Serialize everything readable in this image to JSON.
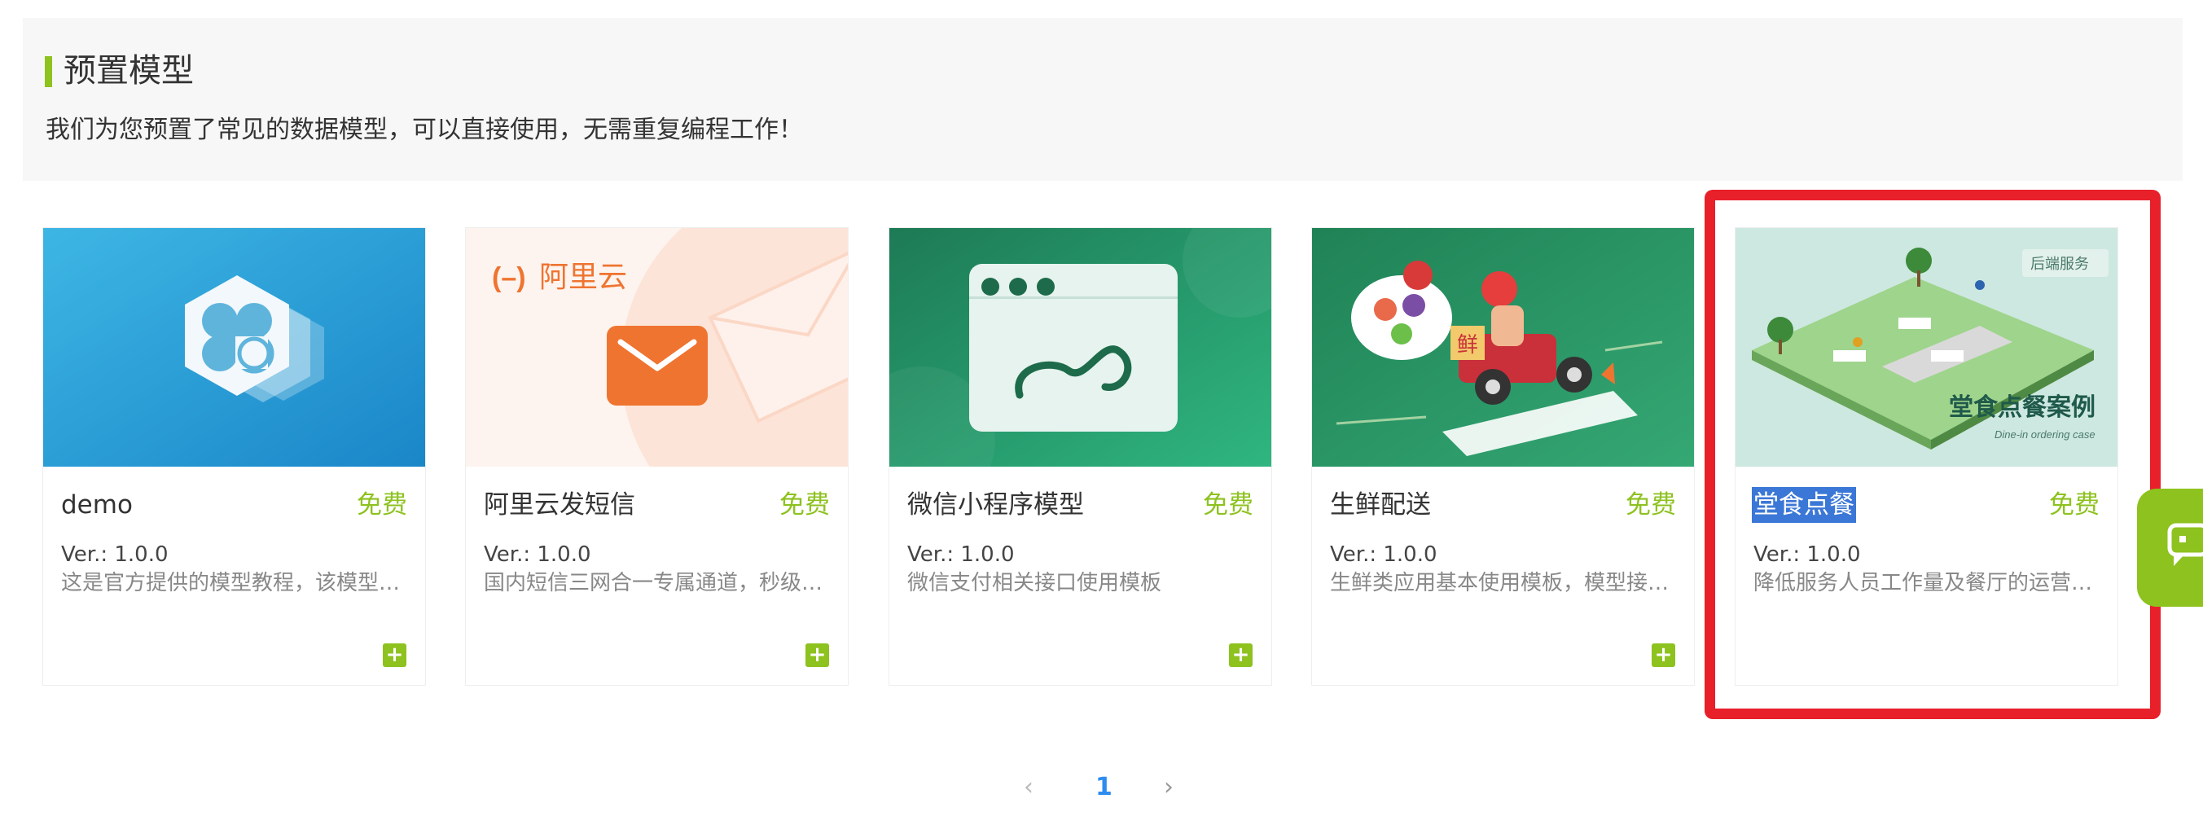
{
  "section": {
    "title": "预置模型",
    "subtitle": "我们为您预置了常见的数据模型，可以直接使用，无需重复编程工作！"
  },
  "accent_color": "#8dc21f",
  "highlight_color": "#e8202a",
  "cards": [
    {
      "name": "demo",
      "price": "免费",
      "version": "Ver.: 1.0.0",
      "description": "这是官方提供的模型教程，该模型…",
      "thumb_icon": "clover-hexagon-icon"
    },
    {
      "name": "阿里云发短信",
      "price": "免费",
      "version": "Ver.: 1.0.0",
      "description": "国内短信三网合一专属通道，秒级…",
      "thumb_icon": "envelope-icon",
      "thumb_logo": "阿里云"
    },
    {
      "name": "微信小程序模型",
      "price": "免费",
      "version": "Ver.: 1.0.0",
      "description": "微信支付相关接口使用模板",
      "thumb_icon": "mini-program-window-icon"
    },
    {
      "name": "生鲜配送",
      "price": "免费",
      "version": "Ver.: 1.0.0",
      "description": "生鲜类应用基本使用模板，模型接…",
      "thumb_icon": "delivery-scooter-icon",
      "thumb_label": "鲜"
    },
    {
      "name": "堂食点餐",
      "price": "免费",
      "version": "Ver.: 1.0.0",
      "description": "降低服务人员工作量及餐厅的运营…",
      "thumb_icon": "restaurant-scene-icon",
      "thumb_tag": "后端服务",
      "thumb_title": "堂食点餐案例",
      "thumb_caption": "Dine-in ordering case"
    }
  ],
  "add_label": "+",
  "pagination": {
    "prev": "‹",
    "current": "1",
    "next": "›"
  }
}
